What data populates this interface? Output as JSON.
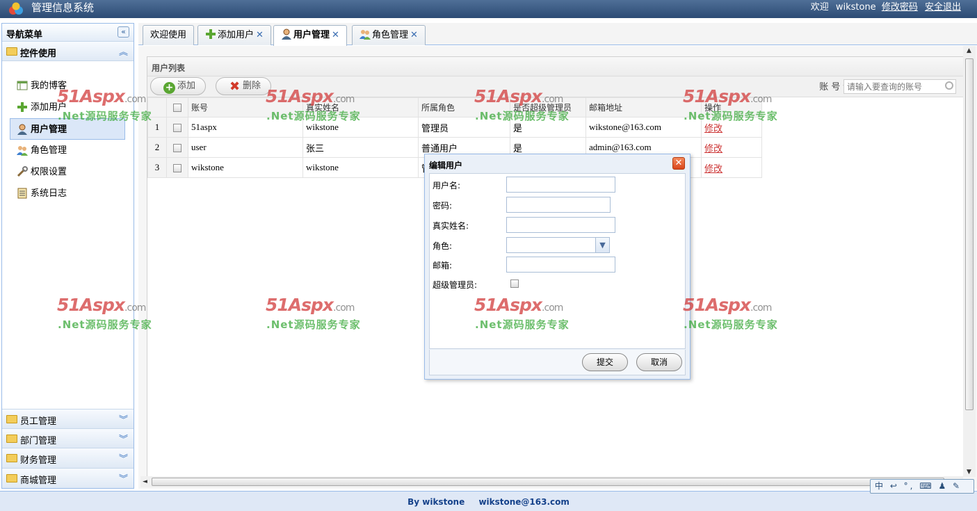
{
  "header": {
    "app_title": "管理信息系统",
    "welcome_prefix": "欢迎",
    "username": "wikstone",
    "change_password": "修改密码",
    "logout": "安全退出"
  },
  "sidebar": {
    "title": "导航菜单",
    "open_section": "控件使用",
    "items": [
      {
        "label": "我的博客",
        "icon": "blog-icon"
      },
      {
        "label": "添加用户",
        "icon": "add-icon"
      },
      {
        "label": "用户管理",
        "icon": "user-icon",
        "selected": true
      },
      {
        "label": "角色管理",
        "icon": "role-icon"
      },
      {
        "label": "权限设置",
        "icon": "wrench-icon"
      },
      {
        "label": "系统日志",
        "icon": "log-icon"
      }
    ],
    "sections": [
      "员工管理",
      "部门管理",
      "财务管理",
      "商城管理"
    ]
  },
  "tabs": [
    {
      "label": "欢迎使用",
      "closable": false
    },
    {
      "label": "添加用户",
      "closable": true
    },
    {
      "label": "用户管理",
      "closable": true,
      "active": true
    },
    {
      "label": "角色管理",
      "closable": true
    }
  ],
  "grid": {
    "title": "用户列表",
    "add_label": "添加",
    "delete_label": "删除",
    "search_field": "账 号",
    "search_placeholder": "请输入要查询的账号",
    "columns": [
      "账号",
      "真实姓名",
      "所属角色",
      "是否超级管理员",
      "邮箱地址",
      "操作"
    ],
    "rows": [
      {
        "num": "1",
        "account": "51aspx",
        "realname": "wikstone",
        "role": "管理员",
        "super": "是",
        "email": "wikstone@163.com",
        "action": "修改"
      },
      {
        "num": "2",
        "account": "user",
        "realname": "张三",
        "role": "普通用户",
        "super": "是",
        "email": "admin@163.com",
        "action": "修改"
      },
      {
        "num": "3",
        "account": "wikstone",
        "realname": "wikstone",
        "role": "管",
        "super": "",
        "email": "",
        "action": "修改"
      }
    ]
  },
  "dialog": {
    "title": "编辑用户",
    "fields": {
      "username": "用户名:",
      "password": "密码:",
      "realname": "真实姓名:",
      "role": "角色:",
      "email": "邮箱:",
      "superadmin": "超级管理员:"
    },
    "submit": "提交",
    "cancel": "取消"
  },
  "footer": {
    "by": "By wikstone",
    "email": "wikstone@163.com"
  },
  "ime": "中 ↩ °, ⌨ ♟ ✎",
  "watermark": {
    "brand": "51Aspx",
    "suffix": ".com",
    "slogan": ".Net源码服务专家"
  },
  "colors": {
    "header_bg": "#2c4b74",
    "border_blue": "#99bbe8",
    "link_red": "#cc3333",
    "watermark_red": "#d23c3c",
    "watermark_green": "#3caa3c"
  }
}
